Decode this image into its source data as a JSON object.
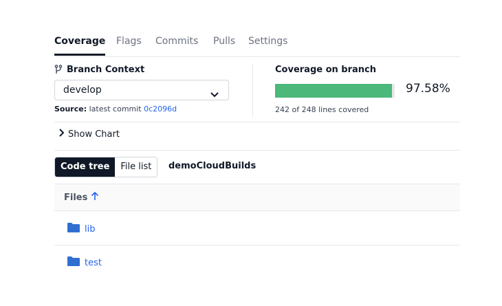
{
  "tabs": [
    {
      "label": "Coverage",
      "active": true
    },
    {
      "label": "Flags"
    },
    {
      "label": "Commits"
    },
    {
      "label": "Pulls"
    },
    {
      "label": "Settings"
    }
  ],
  "branch_context": {
    "title": "Branch Context",
    "selected_branch": "develop",
    "source_label": "Source:",
    "source_text": "latest commit",
    "commit_sha": "0c2096d"
  },
  "coverage": {
    "title": "Coverage on branch",
    "percent_text": "97.58%",
    "percent_value": 97.58,
    "lines_text": "242 of 248 lines covered",
    "bar_color": "#4cb87a"
  },
  "show_chart_label": "Show Chart",
  "view_toggle": {
    "code_tree": "Code tree",
    "file_list": "File list"
  },
  "repo_name": "demoCloudBuilds",
  "files_header": "Files",
  "files": [
    {
      "name": "lib",
      "icon": "folder-icon"
    },
    {
      "name": "test",
      "icon": "folder-icon"
    }
  ]
}
